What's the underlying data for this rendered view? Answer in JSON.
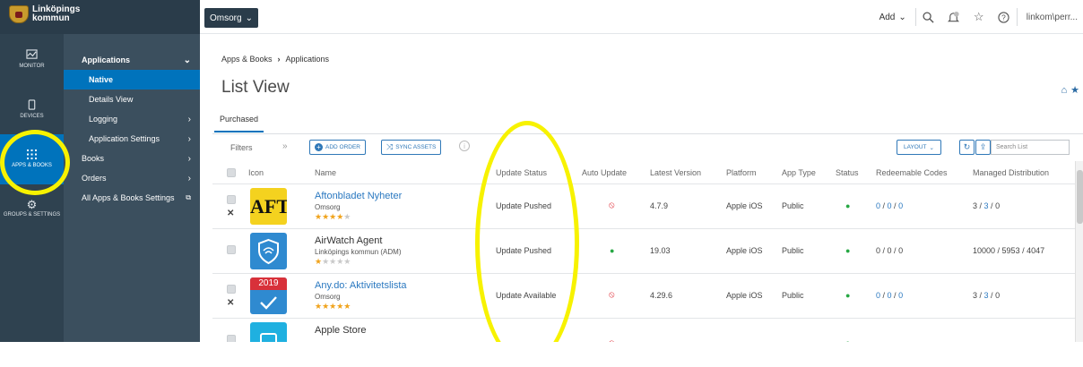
{
  "topbar": {
    "logo_line1": "Linköpings",
    "logo_line2": "kommun",
    "org_label": "Omsorg",
    "add_label": "Add",
    "user_label": "linkom\\perr..."
  },
  "rail": {
    "items": [
      {
        "label": "MONITOR",
        "icon": "monitor-icon"
      },
      {
        "label": "DEVICES",
        "icon": "devices-icon"
      },
      {
        "label": "APPS & BOOKS",
        "icon": "apps-grid-icon"
      },
      {
        "label": "GROUPS & SETTINGS",
        "icon": "gear-icon"
      }
    ]
  },
  "nav": {
    "applications": "Applications",
    "native": "Native",
    "details_view": "Details View",
    "logging": "Logging",
    "application_settings": "Application Settings",
    "books": "Books",
    "orders": "Orders",
    "all_settings": "All Apps & Books Settings"
  },
  "breadcrumb": {
    "root": "Apps & Books",
    "current": "Applications"
  },
  "page": {
    "title": "List View",
    "tab": "Purchased"
  },
  "toolbar": {
    "filters": "Filters",
    "add_order": "ADD ORDER",
    "sync_assets": "SYNC ASSETS",
    "layout": "LAYOUT",
    "search_placeholder": "Search List"
  },
  "columns": {
    "icon": "Icon",
    "name": "Name",
    "update_status": "Update Status",
    "auto_update": "Auto Update",
    "latest_version": "Latest Version",
    "platform": "Platform",
    "app_type": "App Type",
    "status": "Status",
    "redeemable_codes": "Redeemable Codes",
    "managed_distribution": "Managed Distribution"
  },
  "rows": [
    {
      "name": "Aftonbladet Nyheter",
      "publisher": "Omsorg",
      "rating": 4,
      "update_status": "Update Pushed",
      "auto_update": false,
      "latest_version": "4.7.9",
      "platform": "Apple iOS",
      "app_type": "Public",
      "status": "active",
      "codes_a": "0",
      "codes_b": "0",
      "codes_c": "0",
      "md_a": "3",
      "md_b": "3",
      "md_c": "0",
      "icon_text": "AFT"
    },
    {
      "name": "AirWatch Agent",
      "publisher": "Linköpings kommun (ADM)",
      "rating": 1,
      "update_status": "Update Pushed",
      "auto_update": true,
      "latest_version": "19.03",
      "platform": "Apple iOS",
      "app_type": "Public",
      "status": "active",
      "codes_a": "0",
      "codes_b": "0",
      "codes_c": "0",
      "md_a": "10000",
      "md_b": "5953",
      "md_c": "4047"
    },
    {
      "name": "Any.do: Aktivitetslista",
      "publisher": "Omsorg",
      "rating": 5,
      "update_status": "Update Available",
      "auto_update": false,
      "latest_version": "4.29.6",
      "platform": "Apple iOS",
      "app_type": "Public",
      "status": "active",
      "codes_a": "0",
      "codes_b": "0",
      "codes_c": "0",
      "md_a": "3",
      "md_b": "3",
      "md_c": "0",
      "icon_text": "2019"
    },
    {
      "name": "Apple Store",
      "publisher": "",
      "rating": 0,
      "update_status": "",
      "auto_update": false,
      "latest_version": "",
      "platform": "",
      "app_type": "",
      "status": "",
      "codes_a": "",
      "codes_b": "",
      "codes_c": "",
      "md_a": "",
      "md_b": "",
      "md_c": ""
    }
  ],
  "colors": {
    "accent": "#0073bc",
    "rail_bg": "#2f4250",
    "nav_bg": "#3b4f5e",
    "link": "#2a78c0",
    "annotation": "#f7f200",
    "ok": "#27a844",
    "disabled": "#e0303a"
  }
}
